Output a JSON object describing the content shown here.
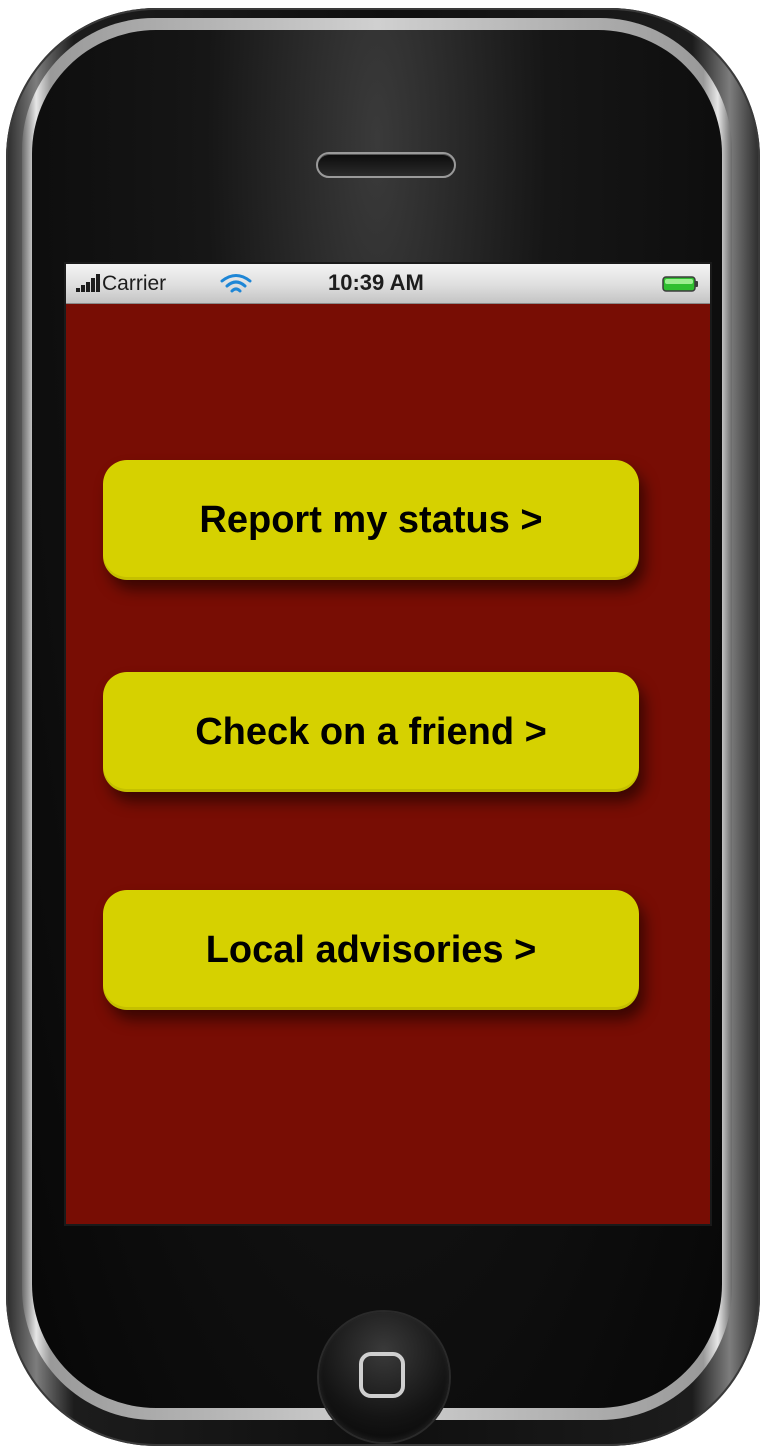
{
  "status_bar": {
    "carrier": "Carrier",
    "time": "10:39 AM"
  },
  "actions": [
    {
      "label": "Report my status >"
    },
    {
      "label": "Check on a friend >"
    },
    {
      "label": "Local advisories >"
    }
  ],
  "colors": {
    "screen_background": "#780d04",
    "button_fill": "#d6d100",
    "button_text": "#000000"
  },
  "icons": {
    "signal": "signal-bars-icon",
    "wifi": "wifi-icon",
    "battery": "battery-icon",
    "home": "home-button-icon"
  }
}
